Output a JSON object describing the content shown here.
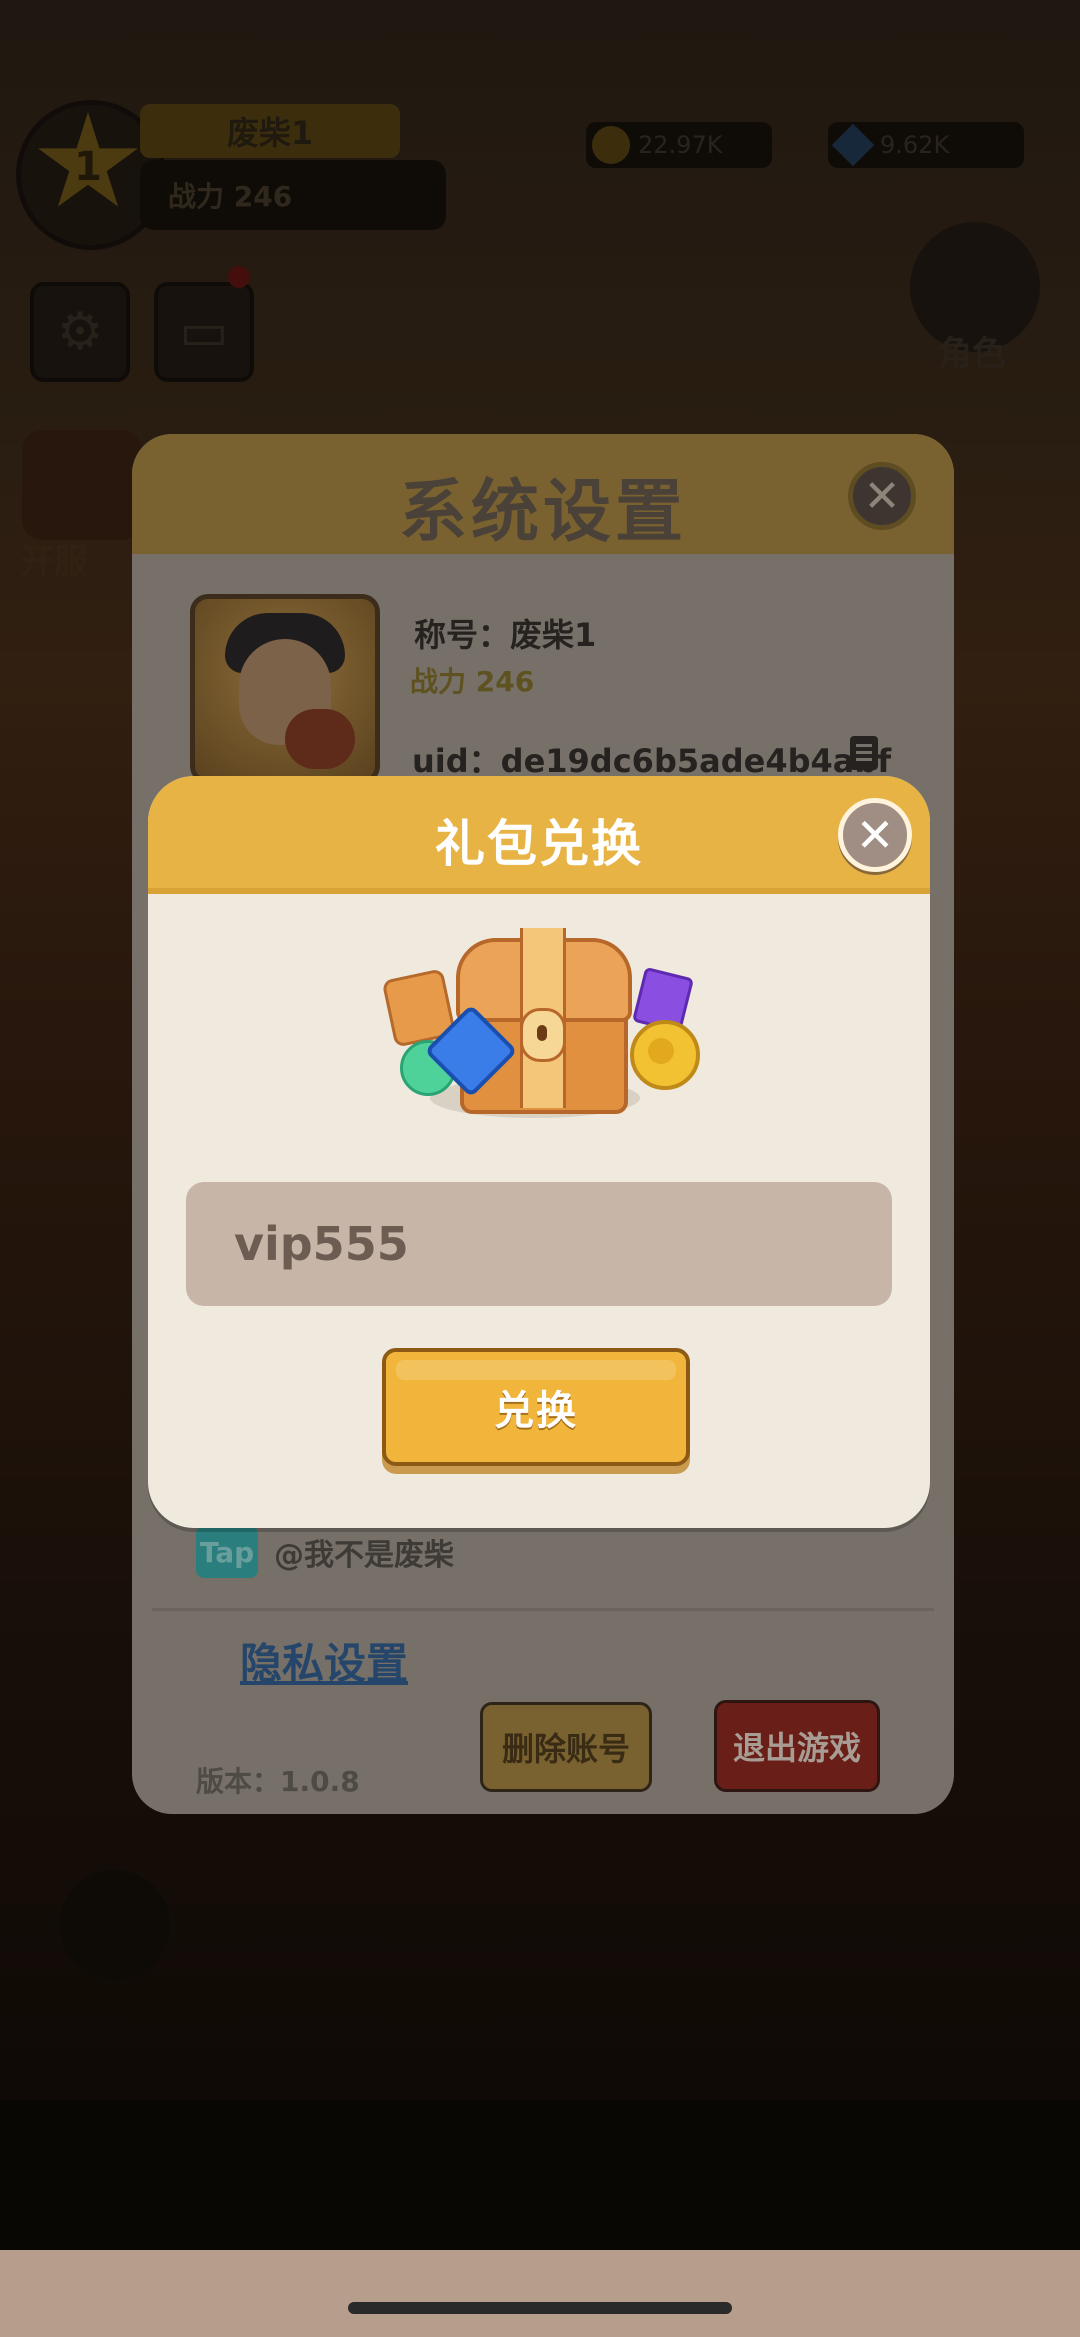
{
  "hud": {
    "level": "1",
    "player_name": "废柴1",
    "power_label": "战力 246",
    "gold": "22.97K",
    "gems": "9.62K",
    "role_label": "角色",
    "side_gift_label": "开服"
  },
  "settings": {
    "title": "系统设置",
    "name_line": "称号：废柴1",
    "power_line": "战力 246",
    "uid_line": "uid：de19dc6b5ade4b4abf",
    "tap_badge": "Tap",
    "tap_account": "@我不是废柴",
    "privacy_link": "隐私设置",
    "version": "版本：1.0.8",
    "delete_button": "删除账号",
    "quit_button": "退出游戏"
  },
  "dialog": {
    "title": "礼包兑换",
    "code_value": "vip555",
    "redeem_button": "兑换"
  },
  "icons": {
    "close": "close-icon",
    "copy": "copy-icon",
    "settings": "gear-icon",
    "book": "book-icon",
    "role": "person-icon",
    "reward": "treasure-chest-icon"
  },
  "colors": {
    "dialog_header": "#e8b345",
    "dialog_body": "#efe9de",
    "input_bg": "#c7b6a7",
    "redeem_button": "#f0b53a"
  }
}
